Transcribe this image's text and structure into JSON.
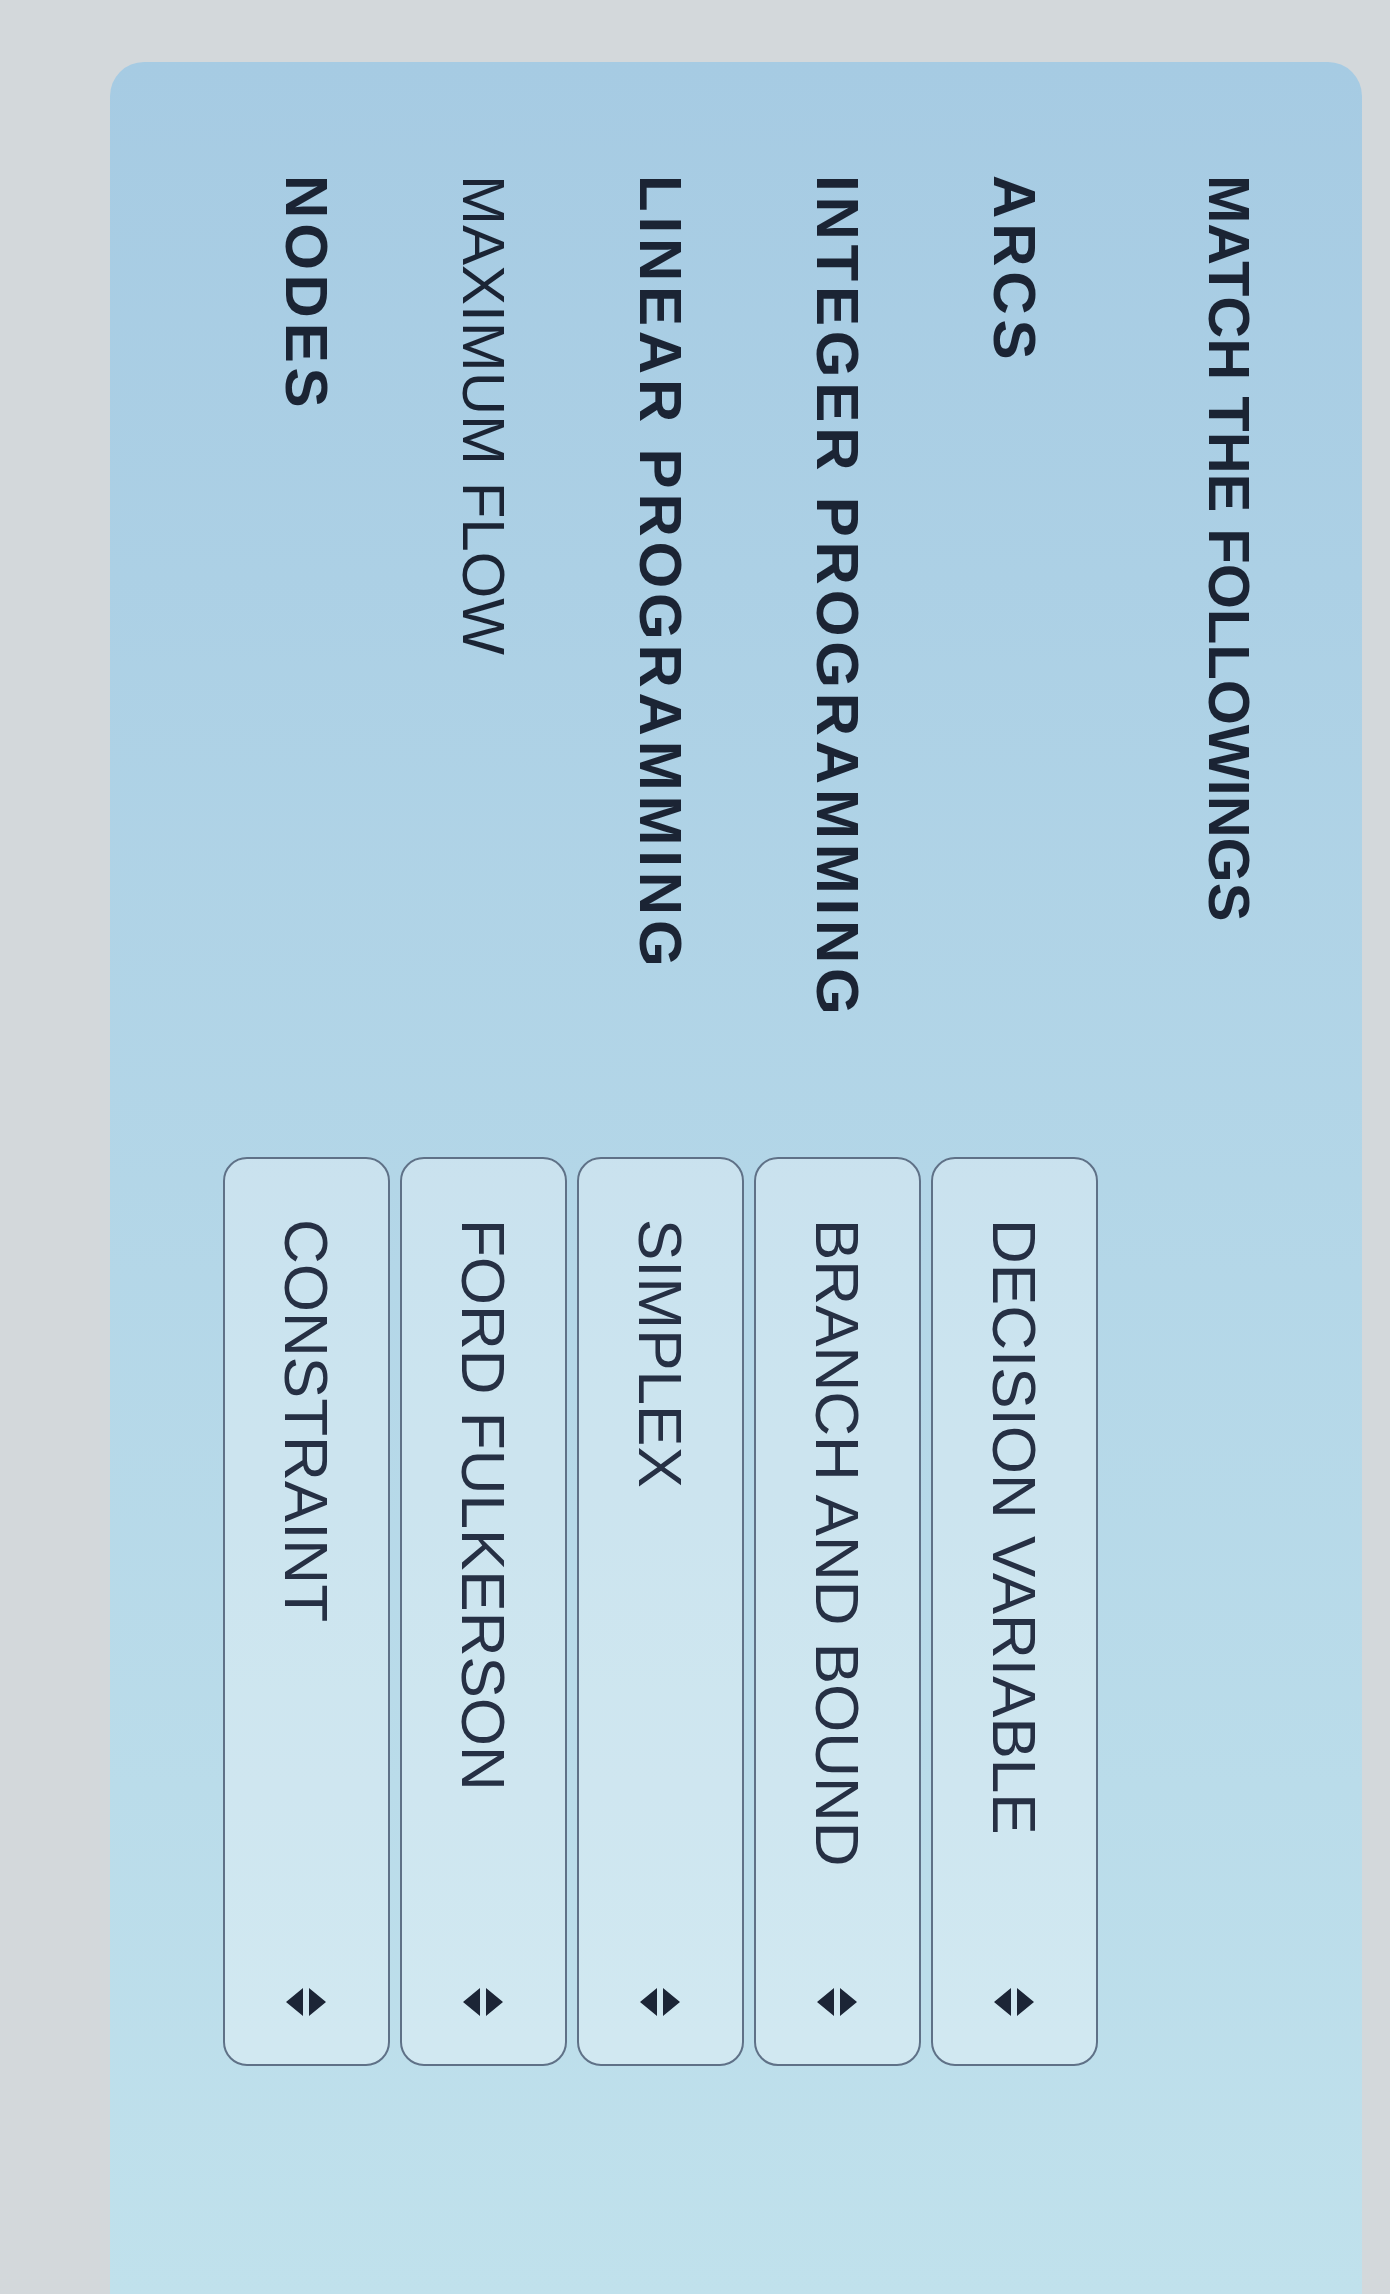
{
  "title": "MATCH THE FOLLOWINGS",
  "rows": [
    {
      "term": "ARCS",
      "bold": true,
      "dropdown": {
        "value": "DECISION VARIABLE"
      }
    },
    {
      "term": "INTEGER PROGRAMMING",
      "bold": true,
      "dropdown": {
        "value": "BRANCH AND BOUND"
      }
    },
    {
      "term": "LINEAR PROGRAMMING",
      "bold": true,
      "dropdown": {
        "value": "SIMPLEX"
      }
    },
    {
      "term": "MAXIMUM FLOW",
      "bold": false,
      "dropdown": {
        "value": "FORD FULKERSON"
      }
    },
    {
      "term": "NODES",
      "bold": true,
      "dropdown": {
        "value": "CONSTRAINT"
      }
    }
  ]
}
